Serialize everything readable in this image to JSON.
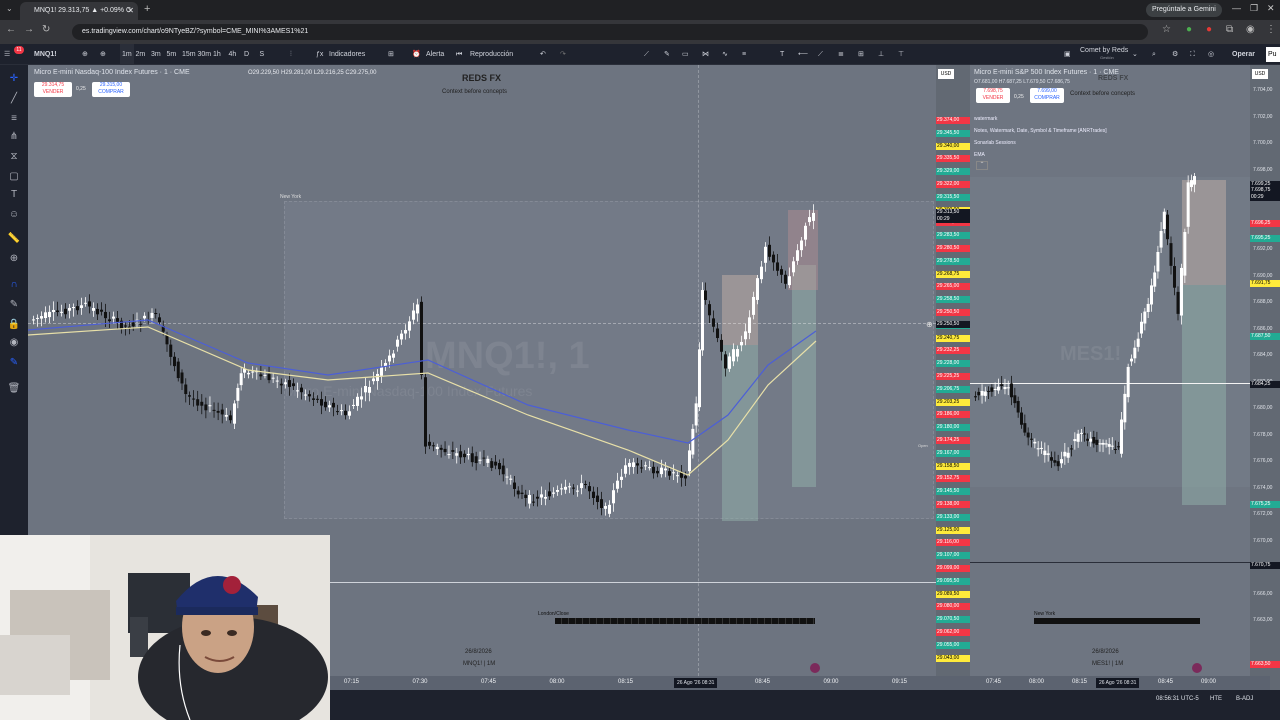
{
  "browser": {
    "tab_title": "MNQ1! 29.313,75 ▲ +0.09% C",
    "url": "es.tradingview.com/chart/o9NTyeBZ/?symbol=CME_MINI%3AMES1%21",
    "gemini": "Pregúntale a Gemini",
    "badge": "11"
  },
  "toolbar": {
    "symbol": "MNQ1!",
    "intervals": [
      "1m",
      "2m",
      "3m",
      "5m",
      "15m",
      "30m",
      "1h",
      "4h",
      "D",
      "S"
    ],
    "indicators": "Indicadores",
    "alert": "Alerta",
    "replay": "Reproducción",
    "account": "Comet by Reds",
    "account_sub": "Gestión",
    "trade": "Operar",
    "publish": "Pu"
  },
  "left_chart": {
    "title": "Micro E-mini Nasdaq-100 Index Futures · 1 · CME",
    "ohlc": "O29.229,50 H29.281,00 L29.216,25 C29.275,00",
    "sell_price": "29.314,75",
    "sell_label": "VENDER",
    "buy_price": "29.315,00",
    "buy_label": "COMPRAR",
    "spread": "0,25",
    "brand": "REDS FX",
    "tagline": "Context before concepts",
    "session_label": "New York",
    "london_label": "London/Close",
    "watermark": "MNQ1!, 1",
    "watermark_sub": "Micro E-mini Nasdaq-100 Index Futures",
    "date": "26/8/2026",
    "symbol_tf": "MNQ1! | 1M",
    "currency": "USD",
    "current_price": "29.313,50",
    "countdown": "00:29",
    "crosshair_price": "29.250,50",
    "open_label": "Open",
    "price_ticks": [
      "29.374,00",
      "29.345,50",
      "29.340,00",
      "29.335,50",
      "29.329,00",
      "29.322,00",
      "29.315,50",
      "29.300,00",
      "29.290,00",
      "29.283,50",
      "29.280,50",
      "29.278,50",
      "29.268,75",
      "29.265,00",
      "29.258,50",
      "29.250,50",
      "29.244,75",
      "29.240,75",
      "29.232,25",
      "29.228,00",
      "29.225,25",
      "29.206,75",
      "29.203,25",
      "29.186,00",
      "29.180,00",
      "29.174,25",
      "29.167,00",
      "29.158,50",
      "29.152,75",
      "29.145,50",
      "29.138,00",
      "29.133,00",
      "29.125,00",
      "29.116,00",
      "29.107,00",
      "29.099,00",
      "29.095,50",
      "29.089,50",
      "29.080,00",
      "29.070,50",
      "29.062,00",
      "29.055,00",
      "29.043,00"
    ],
    "time_ticks": [
      "07:15",
      "07:30",
      "07:45",
      "08:00",
      "08:15",
      "08:30",
      "08:45",
      "09:00",
      "09:15"
    ],
    "cursor_time": "26 Ago '26  08:31"
  },
  "right_chart": {
    "title": "Micro E-mini S&P 500 Index Futures · 1 · CME",
    "ohlc": "O7.681,00 H7.687,25 L7.679,50 C7.686,75",
    "sell_price": "7.698,75",
    "sell_label": "VENDER",
    "buy_price": "7.699,00",
    "buy_label": "COMPRAR",
    "spread": "0,25",
    "brand": "REDS FX",
    "tagline": "Context before concepts",
    "indicators": [
      "watermark",
      "Notes, Watermark, Date, Symbol & Timeframe [ANRTrades]",
      "Sonarlab Sessions",
      "EMA"
    ],
    "session_label": "New York",
    "watermark": "MES1!",
    "date": "26/8/2026",
    "symbol_tf": "MES1! | 1M",
    "currency": "USD",
    "current_price": "7.698,75",
    "countdown": "00:29",
    "price_ticks": [
      "7.704,00",
      "7.702,00",
      "7.700,00",
      "7.698,00",
      "7.696,00",
      "7.694,00",
      "7.692,00",
      "7.690,00",
      "7.688,00",
      "7.686,00",
      "7.684,00",
      "7.682,00",
      "7.680,00",
      "7.678,00",
      "7.676,00",
      "7.674,00",
      "7.672,00",
      "7.670,00",
      "7.668,00",
      "7.666,00",
      "7.663,00"
    ],
    "highlight_ticks": [
      "7.699,25",
      "7.698,75",
      "7.696,25",
      "7.695,25",
      "7.691,75",
      "7.687,50",
      "7.684,25",
      "7.675,25",
      "7.670,75",
      "7.663,50"
    ],
    "time_ticks": [
      "07:45",
      "08:00",
      "08:15",
      "08:30",
      "08:45",
      "09:00"
    ],
    "cursor_time": "26 Ago '26  08:31"
  },
  "status": {
    "clock": "08:56:31 UTC-5",
    "session": "HTE",
    "adj": "B-ADJ"
  },
  "colors": {
    "chart_bg": "#6d7480",
    "panel": "#1e222d",
    "bull": "#ffffff",
    "bear": "#111111",
    "ema_fast": "#4c5fd6",
    "ema_slow": "#e8e0a8",
    "sell": "#f23645",
    "buy": "#2962ff"
  }
}
